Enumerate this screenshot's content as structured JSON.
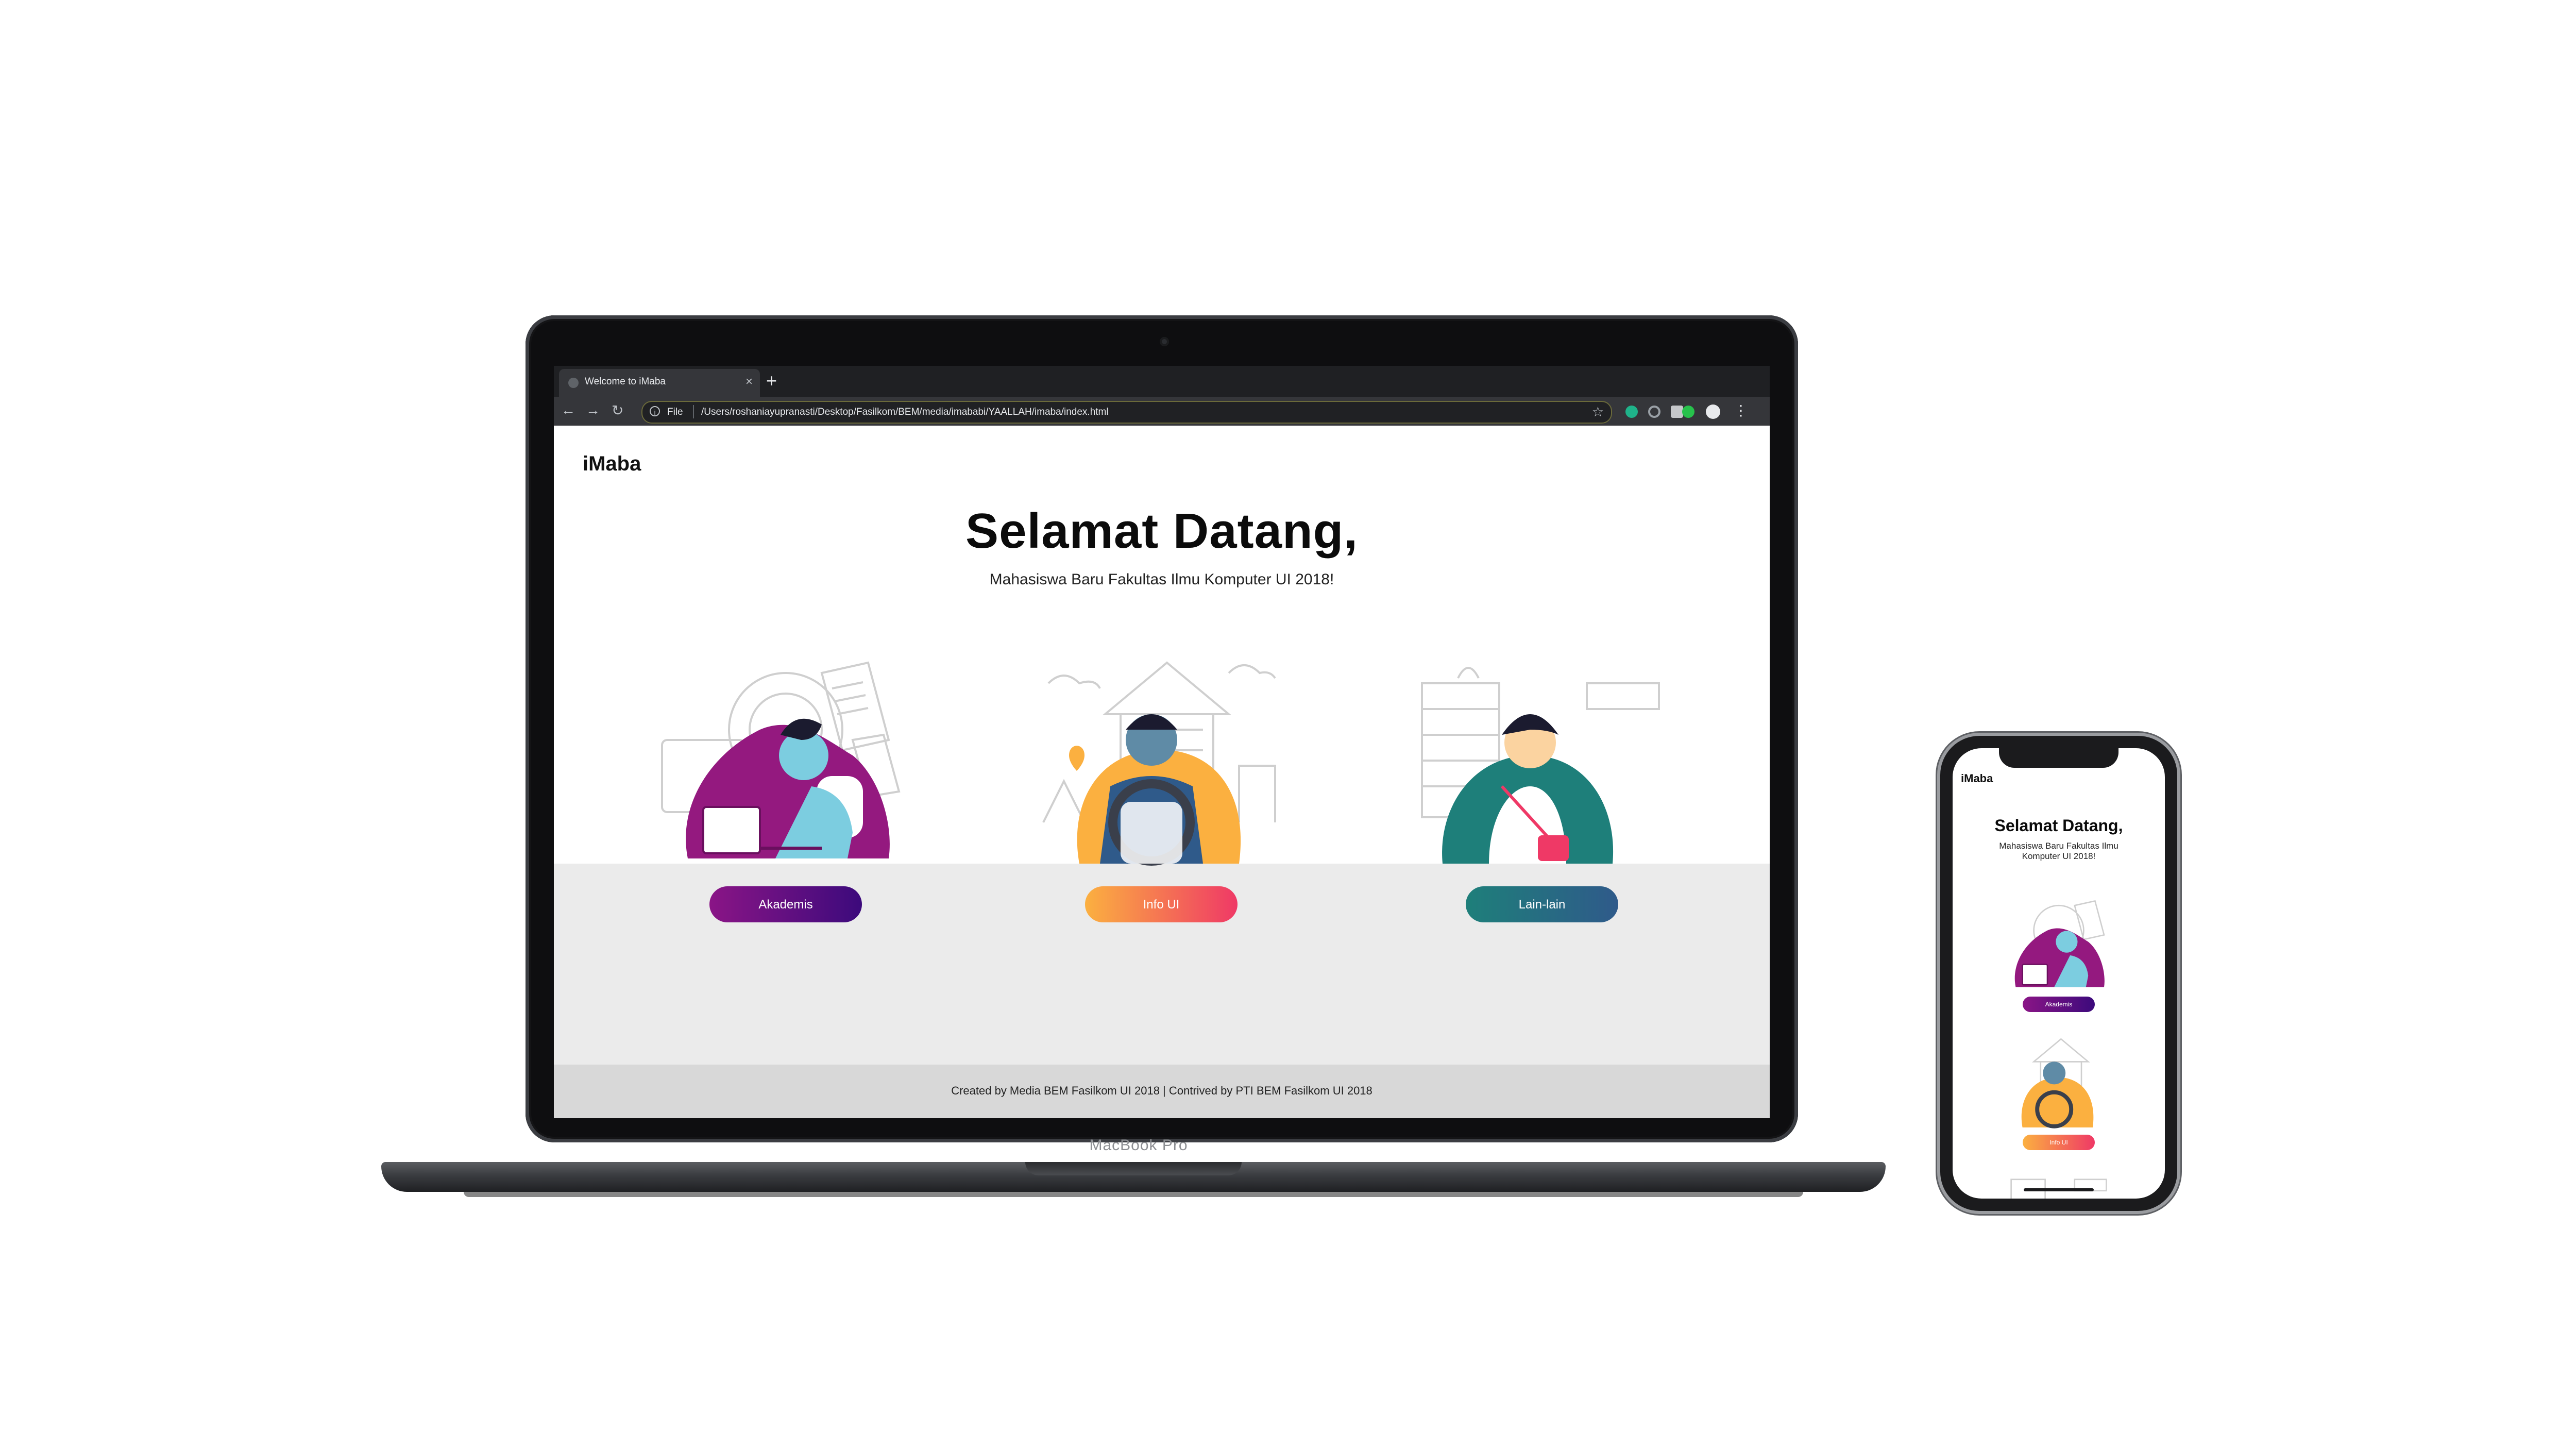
{
  "browser": {
    "tab_title": "Welcome to iMaba",
    "scheme_label": "File",
    "url": "/Users/roshaniayupranasti/Desktop/Fasilkom/BEM/media/imababi/YAALLAH/imaba/index.html",
    "extension_colors": [
      "#1fb38a",
      "#5f6368",
      "#c5c7ca",
      "#27c24c"
    ]
  },
  "site": {
    "brand": "iMaba",
    "hero_title": "Selamat Datang,",
    "hero_subtitle": "Mahasiswa Baru Fakultas Ilmu Komputer UI 2018!",
    "mobile_subtitle": "Mahasiswa Baru Fakultas Ilmu Komputer UI 2018!",
    "cards": [
      {
        "label": "Akademis",
        "illustration": "student-laptop-illustration",
        "gradient": [
          "#8a1586",
          "#3c0a7c"
        ]
      },
      {
        "label": "Info UI",
        "illustration": "driver-campus-illustration",
        "gradient": [
          "#fbb040",
          "#ef3966"
        ]
      },
      {
        "label": "Lain-lain",
        "illustration": "woman-cabinet-illustration",
        "gradient": [
          "#1e7f7a",
          "#2f5a8a"
        ]
      }
    ],
    "footer": "Created by Media BEM Fasilkom UI 2018 | Contrived by PTI BEM Fasilkom UI 2018"
  },
  "device": {
    "laptop_label": "MacBook Pro"
  }
}
